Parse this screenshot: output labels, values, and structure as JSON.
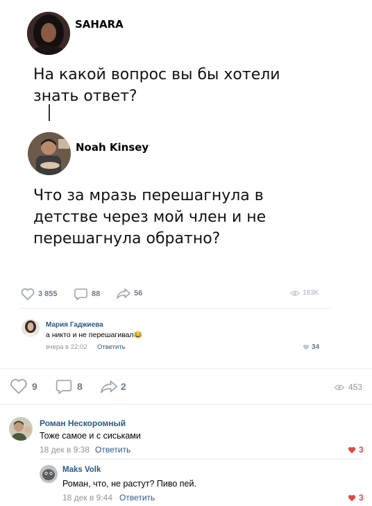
{
  "post": {
    "first_user": "SAHARA",
    "first_text": "На какой вопрос вы бы хотели знать ответ?",
    "reply_user": "Noah Kinsey",
    "reply_text": "Что за мразь перешагнула в детстве через мой член и не перешагнула обратно?",
    "likes": "3 855",
    "comments": "88",
    "shares": "56",
    "views": "183K"
  },
  "inner_comment": {
    "author": "Мария Гаджиева",
    "text": "а никто и не перешагивал",
    "emoji": "😂",
    "time": "вчера в 22:02",
    "reply_label": "Ответить",
    "likes": "34"
  },
  "outer_bar": {
    "likes": "9",
    "comments": "8",
    "shares": "2",
    "views": "453"
  },
  "comments": [
    {
      "author": "Роман Нескоромный",
      "text": "Тоже самое и с сиськами",
      "time": "18 дек в 9:38",
      "reply_label": "Ответить",
      "likes": "3"
    },
    {
      "author": "Maks Volk",
      "text": "Роман, что, не растут? Пиво пей.",
      "time": "18 дек в 9:44",
      "reply_label": "Ответить",
      "likes": "3"
    }
  ],
  "colors": {
    "link": "#2a5885",
    "muted": "#939393",
    "heart": "#e64646",
    "divider": "#e7e8ec"
  }
}
